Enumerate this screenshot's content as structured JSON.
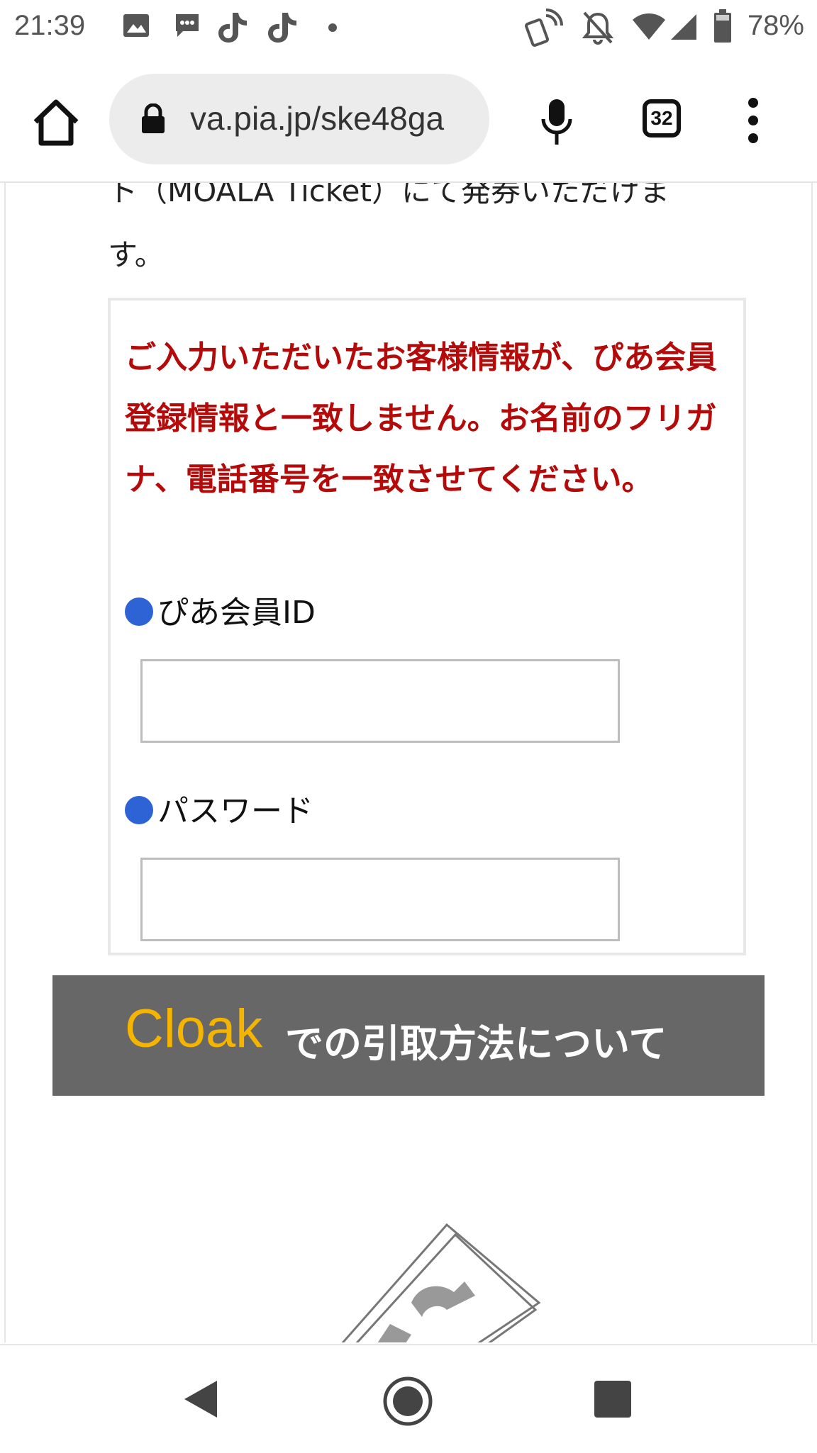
{
  "status_bar": {
    "time": "21:39",
    "battery": "78%",
    "icons": [
      "image-icon",
      "message-icon",
      "tiktok-icon",
      "tiktok-icon",
      "dot-icon",
      "nfc-icon",
      "bell-off-icon",
      "wifi-icon",
      "signal-icon",
      "battery-icon"
    ]
  },
  "browser": {
    "url": "va.pia.jp/ske48ga",
    "tab_count": "32"
  },
  "page": {
    "intro_line1": "ト（MOALA Ticket）にて発券いただけま",
    "intro_line2": "す。",
    "error_message": "ご入力いただいたお客様情報が、ぴあ会員登録情報と一致しません。お名前のフリガナ、電話番号を一致させてください。",
    "fields": [
      {
        "label": "ぴあ会員ID",
        "value": ""
      },
      {
        "label": "パスワード",
        "value": ""
      }
    ],
    "banner": {
      "brand": "Cloak",
      "text": "での引取方法について"
    }
  },
  "colors": {
    "error": "#b40a0a",
    "bullet": "#2e63d6",
    "banner_bg": "#676767",
    "brand": "#f5b400"
  }
}
